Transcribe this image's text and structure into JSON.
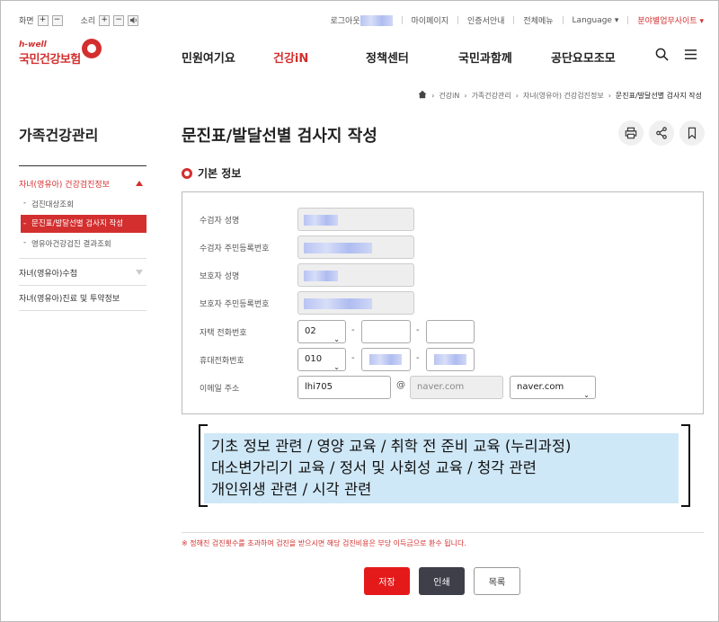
{
  "utility": {
    "screen_label": "화면",
    "sound_label": "소리",
    "plus": "+",
    "minus": "−",
    "logout": "로그아웃",
    "mypage": "마이페이지",
    "cert": "인증서안내",
    "allmenu": "전체메뉴",
    "language": "Language",
    "sites": "분야별업무사이트"
  },
  "logo": {
    "tagline": "h-well",
    "name": "국민건강보험"
  },
  "gnb": [
    "민원여기요",
    "건강iN",
    "정책센터",
    "국민과함께",
    "공단요모조모"
  ],
  "breadcrumb": [
    "건강iN",
    "가족건강관리",
    "자녀(영유아) 건강검진정보",
    "문진표/발달선별 검사지 작성"
  ],
  "side": {
    "title": "가족건강관리",
    "group1": "자녀(영유아) 건강검진정보",
    "sub1": "검진대상조회",
    "sub2": "문진표/발달선별 검사지 작성",
    "sub3": "영유아건강검진 결과조회",
    "group2": "자녀(영유아)수첩",
    "group3": "자녀(영유아)진료 및 투약정보"
  },
  "page": {
    "title": "문진표/발달선별 검사지 작성",
    "section": "기본 정보"
  },
  "form": {
    "examinee_name": "수검자 성명",
    "examinee_rrn": "수검자 주민등록번호",
    "guardian_name": "보호자 성명",
    "guardian_rrn": "보호자 주민등록번호",
    "home_phone": "자택 전화번호",
    "home_area": "02",
    "mobile": "휴대전화번호",
    "mobile_prefix": "010",
    "email": "이메일 주소",
    "email_id": "lhi705",
    "at": "@",
    "email_domain": "naver.com",
    "domain_select": "naver.com",
    "dash": "-"
  },
  "callout": [
    "기초 정보 관련 / 영양 교육 / 취학 전 준비 교육 (누리과정)",
    "대소변가리기 교육 / 정서 및 사회성 교육 / 청각 관련",
    "개인위생 관련 / 시각 관련"
  ],
  "notice": "※ 정해진 검진횟수를 초과하여 검진을 받으시면 해당 검진비용은 부당 이득금으로 환수 됩니다.",
  "buttons": {
    "save": "저장",
    "print": "인쇄",
    "list": "목록"
  },
  "colors": {
    "brand_red": "#d32f2f",
    "callout_bg": "#cfe8f7"
  },
  "icons": [
    "home-icon",
    "search-icon",
    "menu-icon",
    "print-icon",
    "share-icon",
    "bookmark-icon"
  ]
}
